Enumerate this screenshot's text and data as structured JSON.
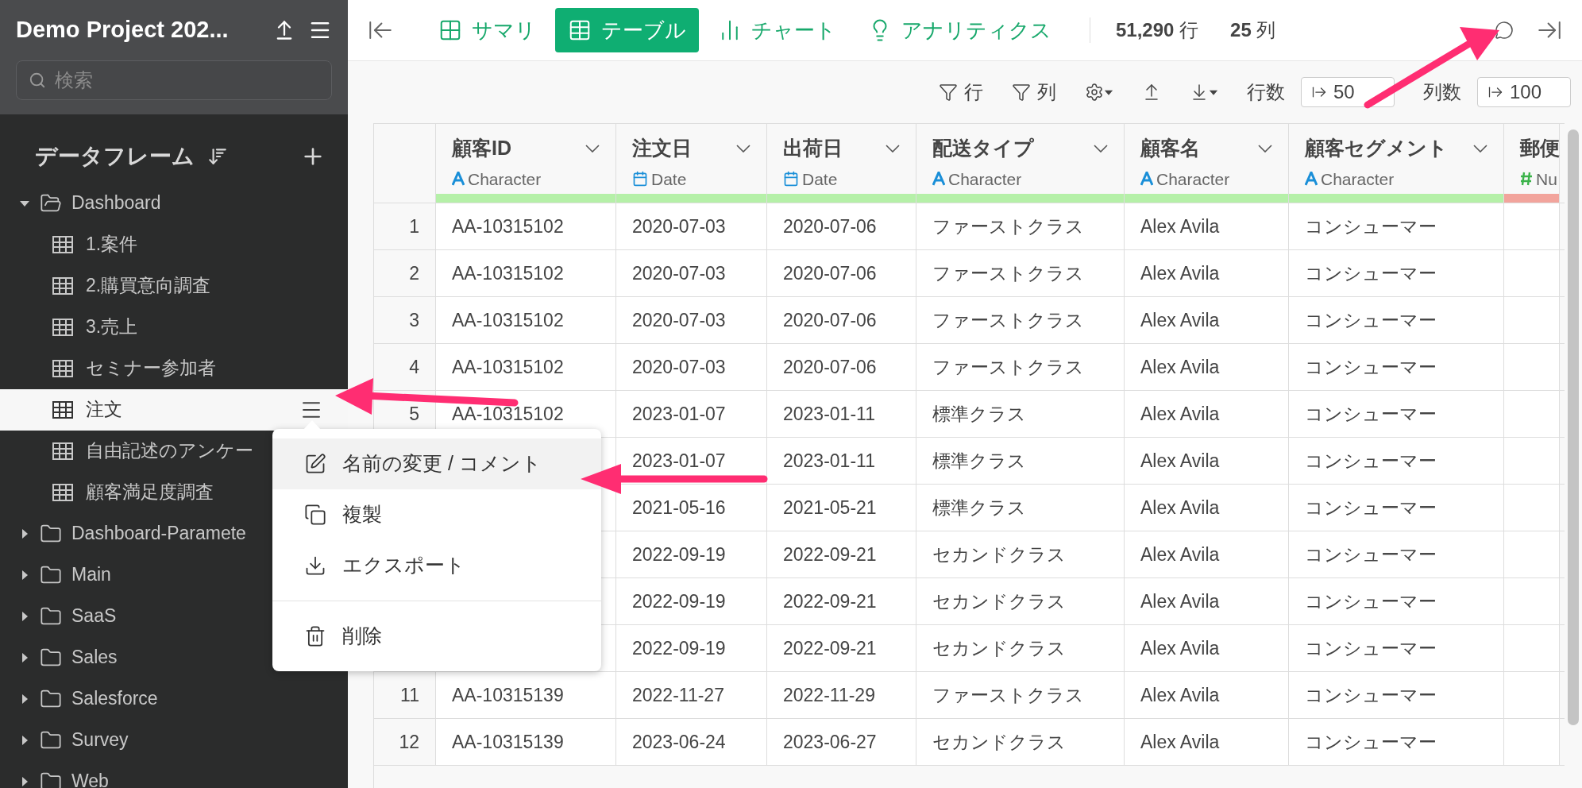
{
  "sidebar": {
    "project_title": "Demo Project 202...",
    "search": {
      "placeholder": "検索"
    },
    "section_title": "データフレーム",
    "tree": [
      {
        "label": "Dashboard",
        "kind": "folder",
        "expanded": true,
        "children": [
          {
            "label": "1.案件",
            "kind": "table",
            "selected": false
          },
          {
            "label": "2.購買意向調査",
            "kind": "table",
            "selected": false
          },
          {
            "label": "3.売上",
            "kind": "table",
            "selected": false
          },
          {
            "label": "セミナー参加者",
            "kind": "table",
            "selected": false
          },
          {
            "label": "注文",
            "kind": "table",
            "selected": true
          },
          {
            "label": "自由記述のアンケー",
            "kind": "table",
            "selected": false
          },
          {
            "label": "顧客満足度調査",
            "kind": "table",
            "selected": false
          }
        ]
      },
      {
        "label": "Dashboard-Paramete",
        "kind": "folder",
        "expanded": false
      },
      {
        "label": "Main",
        "kind": "folder",
        "expanded": false
      },
      {
        "label": "SaaS",
        "kind": "folder",
        "expanded": false
      },
      {
        "label": "Sales",
        "kind": "folder",
        "expanded": false
      },
      {
        "label": "Salesforce",
        "kind": "folder",
        "expanded": false
      },
      {
        "label": "Survey",
        "kind": "folder",
        "expanded": false
      },
      {
        "label": "Web",
        "kind": "folder",
        "expanded": false
      }
    ]
  },
  "context_menu": {
    "items": [
      {
        "label": "名前の変更 / コメント",
        "kind": "rename",
        "selected": true
      },
      {
        "label": "複製",
        "kind": "duplicate",
        "selected": false
      },
      {
        "label": "エクスポート",
        "kind": "export",
        "selected": false
      },
      {
        "label": "削除",
        "kind": "delete",
        "selected": false
      }
    ]
  },
  "view_tabs": [
    {
      "label": "サマリ",
      "kind": "summary",
      "selected": false
    },
    {
      "label": "テーブル",
      "kind": "table",
      "selected": true
    },
    {
      "label": "チャート",
      "kind": "chart",
      "selected": false
    },
    {
      "label": "アナリティクス",
      "kind": "analytics",
      "selected": false
    }
  ],
  "counts": [
    "**51,290** 行",
    "**25** 列"
  ],
  "toolbar": {
    "row_filter": "行",
    "column_filter": "列",
    "rows_label": "行数",
    "rows_value": "50",
    "columns_label": "列数",
    "columns_value": "100"
  },
  "table": {
    "columns": [
      {
        "name": "顧客ID",
        "type": "Character",
        "kind": "character",
        "color": "#b5f0a8"
      },
      {
        "name": "注文日",
        "type": "Date",
        "kind": "date",
        "color": "#b5f0a8"
      },
      {
        "name": "出荷日",
        "type": "Date",
        "kind": "date",
        "color": "#b5f0a8"
      },
      {
        "name": "配送タイプ",
        "type": "Character",
        "kind": "character",
        "color": "#b5f0a8"
      },
      {
        "name": "顧客名",
        "type": "Character",
        "kind": "character",
        "color": "#b5f0a8"
      },
      {
        "name": "顧客セグメント",
        "type": "Character",
        "kind": "character",
        "color": "#b5f0a8"
      },
      {
        "name": "郵便",
        "type": "Nu",
        "kind": "number",
        "color": "#f2a49c"
      }
    ],
    "rows": [
      {
        "number": "1",
        "cells": [
          "AA-10315102",
          "2020-07-03",
          "2020-07-06",
          "ファーストクラス",
          "Alex Avila",
          "コンシューマー"
        ]
      },
      {
        "number": "2",
        "cells": [
          "AA-10315102",
          "2020-07-03",
          "2020-07-06",
          "ファーストクラス",
          "Alex Avila",
          "コンシューマー"
        ]
      },
      {
        "number": "3",
        "cells": [
          "AA-10315102",
          "2020-07-03",
          "2020-07-06",
          "ファーストクラス",
          "Alex Avila",
          "コンシューマー"
        ]
      },
      {
        "number": "4",
        "cells": [
          "AA-10315102",
          "2020-07-03",
          "2020-07-06",
          "ファーストクラス",
          "Alex Avila",
          "コンシューマー"
        ]
      },
      {
        "number": "5",
        "cells": [
          "AA-10315102",
          "2023-01-07",
          "2023-01-11",
          "標準クラス",
          "Alex Avila",
          "コンシューマー"
        ]
      },
      {
        "cells": [
          null,
          "2023-01-07",
          "2023-01-11",
          "標準クラス",
          "Alex Avila",
          "コンシューマー"
        ]
      },
      {
        "cells": [
          null,
          "2021-05-16",
          "2021-05-21",
          "標準クラス",
          "Alex Avila",
          "コンシューマー"
        ]
      },
      {
        "cells": [
          null,
          "2022-09-19",
          "2022-09-21",
          "セカンドクラス",
          "Alex Avila",
          "コンシューマー"
        ]
      },
      {
        "cells": [
          null,
          "2022-09-19",
          "2022-09-21",
          "セカンドクラス",
          "Alex Avila",
          "コンシューマー"
        ]
      },
      {
        "cells": [
          null,
          "2022-09-19",
          "2022-09-21",
          "セカンドクラス",
          "Alex Avila",
          "コンシューマー"
        ]
      },
      {
        "number": "11",
        "cells": [
          "AA-10315139",
          "2022-11-27",
          "2022-11-29",
          "ファーストクラス",
          "Alex Avila",
          "コンシューマー"
        ]
      },
      {
        "number": "12",
        "cells": [
          "AA-10315139",
          "2023-06-24",
          "2023-06-27",
          "セカンドクラス",
          "Alex Avila",
          "コンシューマー"
        ]
      }
    ]
  }
}
